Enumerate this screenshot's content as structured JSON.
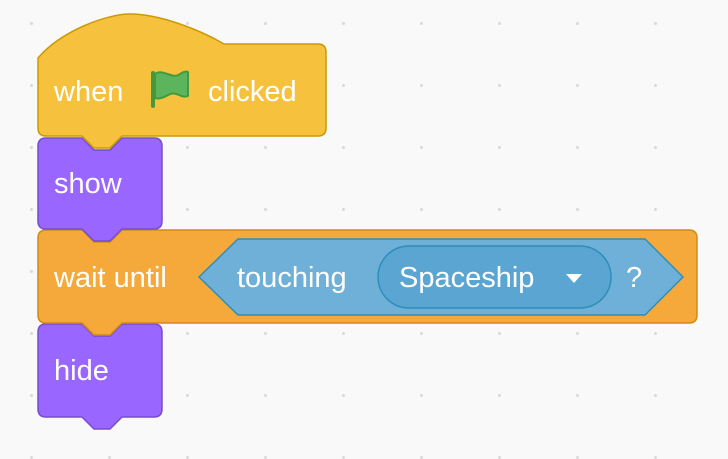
{
  "workspace": {
    "background_color": "#f9f9f9",
    "grid_dot_color": "#d9d9d9"
  },
  "script": {
    "hat_block": {
      "category": "events",
      "color": "#ffbf00",
      "fill_color": "#f6c23e",
      "border_color": "#cc9900",
      "label_before_icon": "when",
      "icon": "green-flag-icon",
      "label_after_icon": "clicked"
    },
    "show_block": {
      "category": "looks",
      "fill_color": "#9966ff",
      "border_color": "#774dcb",
      "label": "show"
    },
    "wait_until_block": {
      "category": "control",
      "fill_color": "#f6a93b",
      "border_color": "#cf8b17",
      "label": "wait until",
      "condition": {
        "category": "sensing",
        "fill_color": "#6fb0d8",
        "border_color": "#2e8eb8",
        "label": "touching",
        "menu": {
          "selected": "Spaceship",
          "fill_color": "#5aa5d1",
          "border_color": "#2e8eb8",
          "icon": "dropdown-arrow-icon"
        },
        "suffix": "?"
      }
    },
    "hide_block": {
      "category": "looks",
      "fill_color": "#9966ff",
      "border_color": "#774dcb",
      "label": "hide"
    }
  }
}
